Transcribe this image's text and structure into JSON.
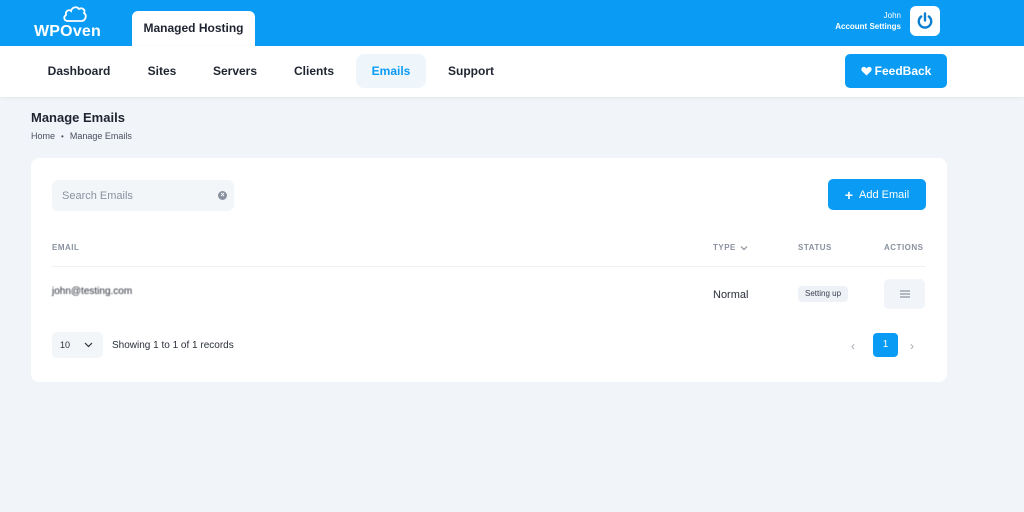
{
  "brand": {
    "name": "WPOven"
  },
  "header": {
    "product_tab": "Managed Hosting",
    "account": {
      "user_name": "John",
      "settings_label": "Account Settings"
    }
  },
  "nav": {
    "items": [
      {
        "label": "Dashboard",
        "active": false
      },
      {
        "label": "Sites",
        "active": false
      },
      {
        "label": "Servers",
        "active": false
      },
      {
        "label": "Clients",
        "active": false
      },
      {
        "label": "Emails",
        "active": true
      },
      {
        "label": "Support",
        "active": false
      }
    ],
    "feedback_label": "FeedBack"
  },
  "page": {
    "title": "Manage Emails",
    "breadcrumb": [
      "Home",
      "Manage Emails"
    ]
  },
  "toolbar": {
    "search_placeholder": "Search Emails",
    "search_value": "",
    "add_label": "Add Email"
  },
  "table": {
    "headers": {
      "email": "EMAIL",
      "type": "TYPE",
      "status": "STATUS",
      "actions": "ACTIONS"
    },
    "rows": [
      {
        "email": "john@testing.com",
        "type": "Normal",
        "status": "Setting up"
      }
    ]
  },
  "pagination": {
    "page_size": "10",
    "summary": "Showing 1 to 1 of 1 records",
    "current_page": "1"
  },
  "colors": {
    "accent": "#0a9cf5",
    "background": "#f1f4f8"
  },
  "icons": [
    "logo-cloud-icon",
    "power-icon",
    "heart-icon",
    "clear-icon",
    "plus-icon",
    "chevron-down-icon",
    "menu-icon",
    "chevron-left-icon",
    "chevron-right-icon"
  ]
}
